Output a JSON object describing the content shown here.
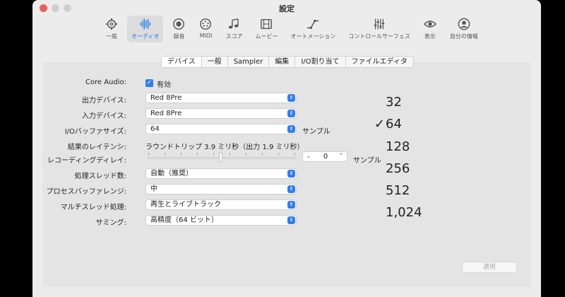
{
  "window": {
    "title": "設定"
  },
  "toolbar": {
    "items": [
      {
        "label": "一般",
        "icon": "gear-icon"
      },
      {
        "label": "オーディオ",
        "icon": "waveform-icon",
        "active": true
      },
      {
        "label": "録音",
        "icon": "record-icon"
      },
      {
        "label": "MIDI",
        "icon": "midi-icon"
      },
      {
        "label": "スコア",
        "icon": "music-note-icon"
      },
      {
        "label": "ムービー",
        "icon": "film-icon"
      },
      {
        "label": "オートメーション",
        "icon": "automation-icon"
      },
      {
        "label": "コントロールサーフェス",
        "icon": "sliders-icon"
      },
      {
        "label": "表示",
        "icon": "eye-icon"
      },
      {
        "label": "自分の情報",
        "icon": "person-icon"
      }
    ]
  },
  "tabs": [
    {
      "label": "デバイス",
      "active": true
    },
    {
      "label": "一般"
    },
    {
      "label": "Sampler"
    },
    {
      "label": "編集"
    },
    {
      "label": "I/O割り当て"
    },
    {
      "label": "ファイルエディタ"
    }
  ],
  "form": {
    "core_audio_label": "Core Audio:",
    "core_audio_value": "有効",
    "output_label": "出力デバイス:",
    "output_value": "Red 8Pre",
    "input_label": "入力デバイス:",
    "input_value": "Red 8Pre",
    "buffer_label": "I/Oバッファサイズ:",
    "buffer_value": "64",
    "buffer_unit": "サンプル",
    "latency_label": "結果のレイテンシ:",
    "latency_value": "ラウンドトリップ 3.9 ミリ秒（出力 1.9 ミリ秒）",
    "rec_delay_label": "レコーディングディレイ:",
    "rec_delay_value": "0",
    "rec_delay_unit": "サンプル",
    "threads_label": "処理スレッド数:",
    "threads_value": "自動（推奨）",
    "process_buffer_label": "プロセスバッファレンジ:",
    "process_buffer_value": "中",
    "multithread_label": "マルチスレッド処理:",
    "multithread_value": "再生とライブトラック",
    "summing_label": "サミング:",
    "summing_value": "高精度（64 ビット）"
  },
  "buffer_menu": {
    "options": [
      "32",
      "64",
      "128",
      "256",
      "512",
      "1,024"
    ],
    "selected": "64",
    "check_glyph": "✓"
  },
  "apply_label": "適用",
  "colors": {
    "accent": "#2f7ff0",
    "close": "#ec5f57"
  }
}
